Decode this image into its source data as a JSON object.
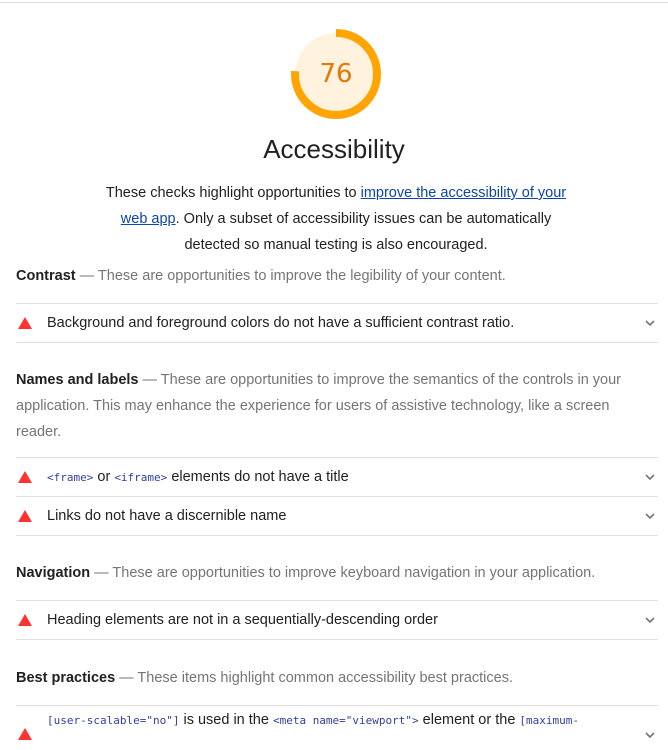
{
  "category": {
    "score": "76",
    "score_fraction": 0.76,
    "score_color": "#ffa400",
    "score_bg": "#fff3e0",
    "title": "Accessibility",
    "description_pre": "These checks highlight opportunities to ",
    "description_link": "improve the accessibility of your web app",
    "description_post": ". Only a subset of accessibility issues can be automatically detected so manual testing is also encouraged."
  },
  "groups": [
    {
      "title": "Contrast",
      "description": " — These are opportunities to improve the legibility of your content.",
      "audits": [
        {
          "title": "Background and foreground colors do not have a sufficient contrast ratio."
        }
      ]
    },
    {
      "title": "Names and labels",
      "description": " — These are opportunities to improve the semantics of the controls in your application. This may enhance the experience for users of assistive technology, like a screen reader.",
      "audits": [
        {
          "code1": "<frame>",
          "mid": " or ",
          "code2": "<iframe>",
          "rest": " elements do not have a title"
        },
        {
          "title": "Links do not have a discernible name"
        }
      ]
    },
    {
      "title": "Navigation",
      "description": " — These are opportunities to improve keyboard navigation in your application.",
      "audits": [
        {
          "title": "Heading elements are not in a sequentially-descending order"
        }
      ]
    },
    {
      "title": "Best practices",
      "description": " — These items highlight common accessibility best practices.",
      "audits": [
        {
          "code1": "[user-scalable=\"no\"]",
          "mid": " is used in the ",
          "code2": "<meta name=\"viewport\">",
          "rest": " element or the ",
          "code3": "[maximum-"
        }
      ]
    }
  ],
  "icons": {
    "fail": "red-triangle-icon",
    "expand": "chevron-down-icon"
  }
}
